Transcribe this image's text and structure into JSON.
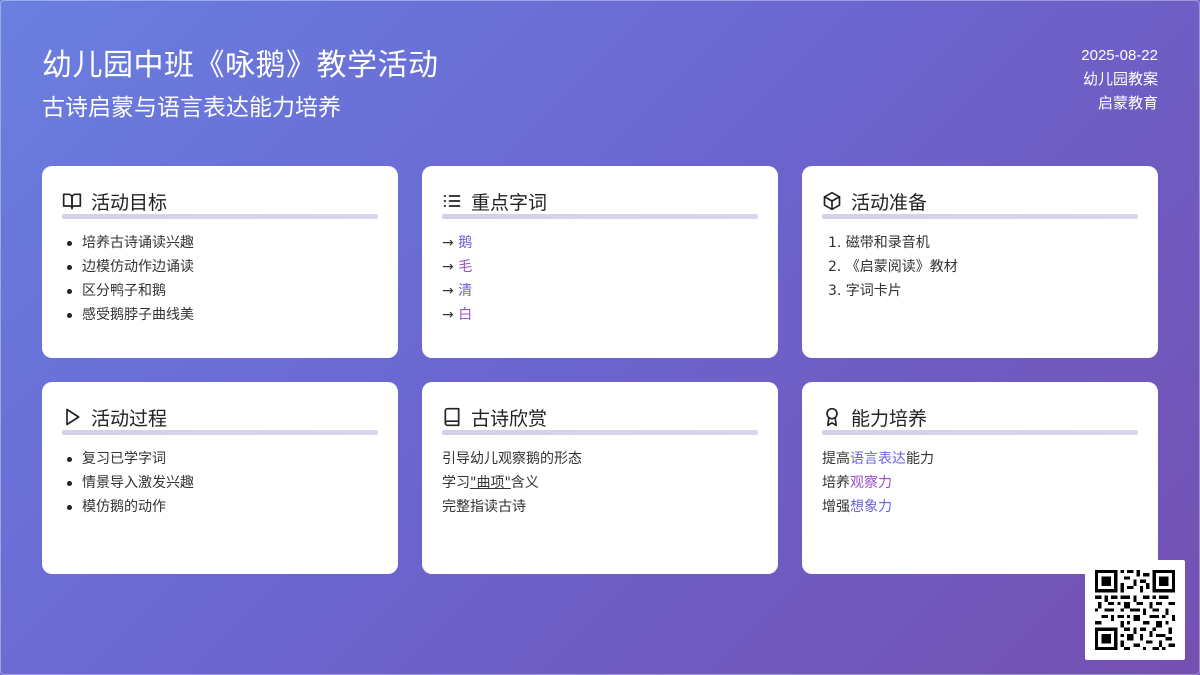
{
  "header": {
    "title": "幼儿园中班《咏鹅》教学活动",
    "subtitle": "古诗启蒙与语言表达能力培养",
    "date": "2025-08-22",
    "category": "幼儿园教案",
    "tag": "启蒙教育"
  },
  "cards": {
    "goals": {
      "title": "活动目标",
      "icon": "book-open-icon",
      "items": [
        "培养古诗诵读兴趣",
        "边模仿动作边诵读",
        "区分鸭子和鹅",
        "感受鹅脖子曲线美"
      ]
    },
    "keywords": {
      "title": "重点字词",
      "icon": "list-icon",
      "arrow": "→",
      "items": [
        "鹅",
        "毛",
        "清",
        "白"
      ]
    },
    "prep": {
      "title": "活动准备",
      "icon": "box-icon",
      "items": [
        "1. 磁带和录音机",
        "2. 《启蒙阅读》教材",
        "3. 字词卡片"
      ]
    },
    "process": {
      "title": "活动过程",
      "icon": "play-icon",
      "items": [
        "复习已学字词",
        "情景导入激发兴趣",
        "模仿鹅的动作"
      ]
    },
    "appreciation": {
      "title": "古诗欣赏",
      "icon": "book-icon",
      "line1": "引导幼儿观察鹅的形态",
      "line2_pre": "学习",
      "line2_term": "\"曲项\"",
      "line2_post": "含义",
      "line3": "完整指读古诗"
    },
    "ability": {
      "title": "能力培养",
      "icon": "award-icon",
      "l1_pre": "提高",
      "l1_hl": "语言表达",
      "l1_post": "能力",
      "l2_pre": "培养",
      "l2_hl": "观察力",
      "l3_pre": "增强",
      "l3_hl": "想象力"
    }
  },
  "qr": {
    "icon": "qr-code-icon"
  }
}
